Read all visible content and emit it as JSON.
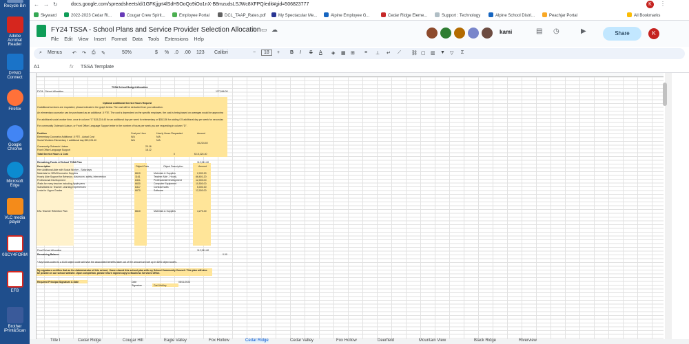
{
  "desktop": {
    "icons": [
      {
        "label": "Recycle Bin",
        "color": "#6e8fbf"
      },
      {
        "label": "Adobe Acrobat Reader",
        "color": "#d6261e"
      },
      {
        "label": "DYMO Connect",
        "color": "#1a73c8"
      },
      {
        "label": "Firefox",
        "color": "#ff7139"
      },
      {
        "label": "Google Chrome",
        "color": "#4285f4"
      },
      {
        "label": "Microsoft Edge",
        "color": "#0c8bd1"
      },
      {
        "label": "VLC media player",
        "color": "#f48b1a"
      },
      {
        "label": "0SCY4FORM",
        "color": "#d6261e"
      },
      {
        "label": "EFB",
        "color": "#d6261e"
      },
      {
        "label": "Brother iPrint&Scan",
        "color": "#3a5a9a"
      }
    ]
  },
  "browser": {
    "url": "docs.google.com/spreadsheets/d/1GFKjjgrt4lSdH5OoQo9iOo1nX-B8mzudsLSJWc8XFPQ/edit#gid=506823777",
    "bookmarks": [
      "Skyward",
      "2022-2023 Cedar Ri...",
      "Cougar Crew Spirit...",
      "Employee Portal",
      "DCL_TAAP_Rates.pdf",
      "My Spectacular Me...",
      "Alpine Employee G...",
      "Cedar Ridge Eleme...",
      "Support : Technology",
      "Alpine School Distri...",
      "Peachjar Portal"
    ],
    "all_bookmarks": "All Bookmarks"
  },
  "sheet": {
    "title": "FY24 TSSA - School Plans and Service Provider Selection Allocation",
    "menus": [
      "File",
      "Edit",
      "View",
      "Insert",
      "Format",
      "Data",
      "Tools",
      "Extensions",
      "Help"
    ],
    "share": "Share",
    "kami": "kami",
    "user_initial": "K",
    "toolbar": {
      "search": "Menus",
      "zoom": "50%",
      "currency": "$",
      "percent": "%",
      "dec1": ".0",
      "dec2": ".00",
      "num": "123",
      "font": "Calibri",
      "size": "18",
      "bold": "B",
      "italic": "I",
      "strike": "S",
      "textcolor": "A",
      "sigma": "Σ"
    },
    "namebox": "A1",
    "fx": "fx",
    "formula": "TSSA Template",
    "content": {
      "budget_title": "TSSA School Budget Allocation",
      "fy24_label": "FY24 - School Allocation",
      "fy24_amount": "127,566.00",
      "optional_title": "Optional Additional Service Hours Request",
      "note1": "If additional services are requested, please indicate in the graph below. The cost will be deducted from your allocation.",
      "note2": "An elementary counselor can be purchased as an additional .5 FTE. The cost is dependent on the specific employee, the cost is being based on averages would be approximately $39,750",
      "note3": "For additional social worker time, once in column \"C\" $15,224.40 for an additional day per week for elementary or $38,136 for adding 0.5 additional day per week for secondary.",
      "note4": "For community Outreach Liaison, or Front Office Language Support enter in the number of hours per week you are requesting in column \"D\".",
      "hdr_position": "Position",
      "hdr_cost": "Cost per Hour",
      "hdr_hours": "Hourly Hours Requested",
      "hdr_amount": "Amount",
      "row1": "Elementary Counselor Additional .5 FTE - Actual Cost",
      "row1_cost": "N/A",
      "row1_hours": "N/A",
      "row2": "Social Workers Elementary 1 additional day $15,224.40",
      "row2_cost": "N/A",
      "row2_hours": "N/A",
      "row2_amount": "15,224.40",
      "row3": "Community Outreach Liaison",
      "row3_cost": "20.16",
      "row4": "Front Office Language Support",
      "row4_cost": "18.12",
      "total_label": "Total Service Hours & Cost",
      "total_hours": "0",
      "total_amount": "$ 15,224.40",
      "remaining_label": "Remaining Funds of School TSSA Plan",
      "remaining_amount": "112,341.60",
      "desc_hdr": "Description",
      "objcode_hdr": "Object Code",
      "objdesc_hdr": "Object Description",
      "amt_hdr": "Amount",
      "items": [
        {
          "d": "Hire Additional Aide with Social Worker - Saturdays",
          "c": "",
          "o": "",
          "a": ""
        },
        {
          "d": "Materials for SEM/Counselor Supplies",
          "c": "6610",
          "o": "Materials & Supplies",
          "a": "2,000.00"
        },
        {
          "d": "Hourly Aide Support for Behavior, classroom, safety, intervention",
          "c": "1161",
          "o": "Teacher Aide - Hourly",
          "a": "66,601.20"
        },
        {
          "d": "Professional Development",
          "c": "6321",
          "o": "Professional Development",
          "a": "12,000.00"
        },
        {
          "d": "iPads for every teacher including Apple pens",
          "c": "6630",
          "o": "Computer Equipment",
          "a": "10,500.00"
        },
        {
          "d": "Substitutes for Teacher Learning Experiences",
          "c": "6317",
          "o": "Contract subs",
          "a": "5,000.00"
        },
        {
          "d": "Lexia for Upper Grades",
          "c": "6670",
          "o": "Software",
          "a": "12,000.00"
        },
        {
          "d": "EAL Teacher Retention Plan",
          "c": "6610",
          "o": "Materials & Supplies",
          "a": "4,270.40"
        }
      ],
      "final_label": "Final School Allocation",
      "final_amount": "112,341.60",
      "balance_label": "Remaining Balance",
      "balance_amount": "0.00",
      "footnote": "* Any funds coded to a 6100 object code will have the associated benefits taken out of the amount and set up in 6200 object codes.",
      "sig_note": "My signature certifies that as the Administrator of this school, I have shared this school plan with my School Community Council. This plan will also be posted on our school website. Upon completion, please return signed copy to Business Services Office.",
      "req_sig": "Required Principal Signature & Date",
      "date_label": "Date",
      "date_value": "08/11/2023",
      "sig_label": "Signature",
      "sig_value": "Cari Mobley"
    },
    "tabs": [
      "Title I",
      "Cedar Ridge",
      "Cougar Hill",
      "Eagle Valley",
      "Fox Hollow",
      "Cedar Ridge",
      "Cedar Valley",
      "Fox Hollow",
      "Deerfield",
      "Mountain View",
      "Black Ridge",
      "Riverview"
    ]
  }
}
